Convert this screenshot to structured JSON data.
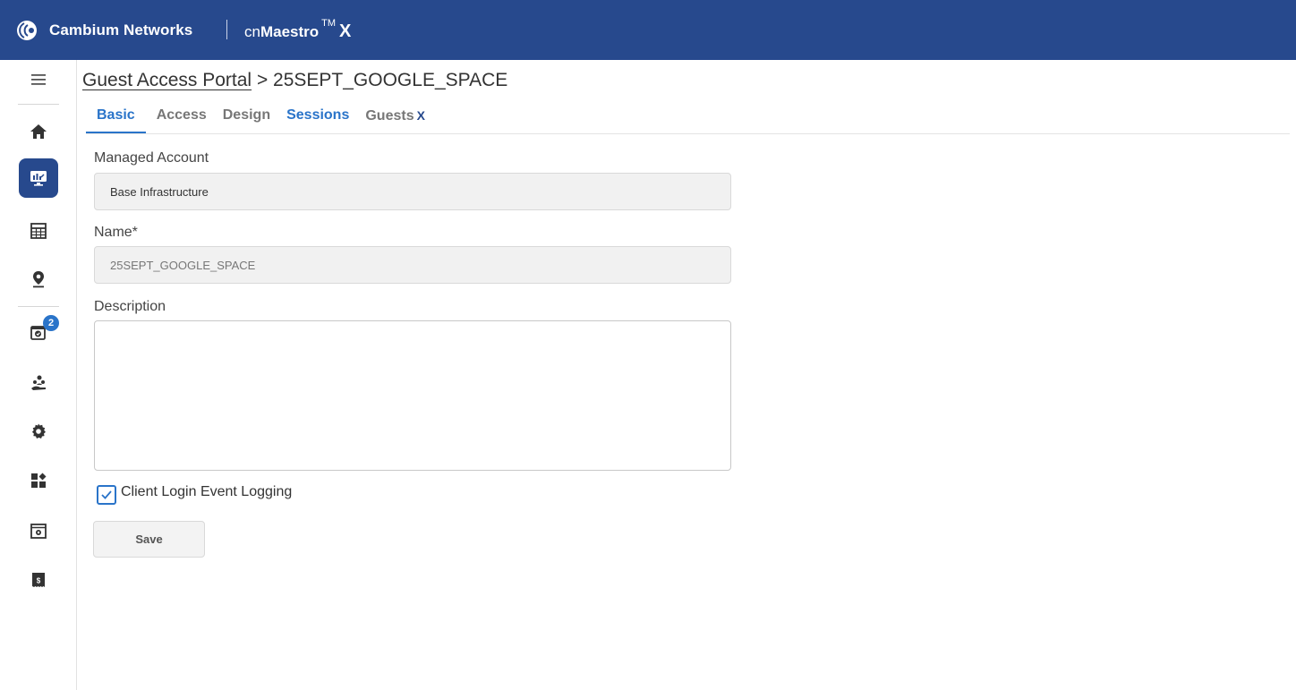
{
  "header": {
    "brand": "Cambium Networks",
    "product_prefix": "cn",
    "product_name": "Maestro",
    "product_tm": "TM",
    "product_suffix": "X"
  },
  "sidebar": {
    "items": [
      {
        "icon": "menu-icon"
      },
      {
        "icon": "home-icon"
      },
      {
        "icon": "monitor-icon",
        "active": true
      },
      {
        "icon": "table-icon"
      },
      {
        "icon": "location-pin-icon"
      },
      {
        "icon": "calendar-check-icon",
        "badge": "2"
      },
      {
        "icon": "users-icon"
      },
      {
        "icon": "gear-icon"
      },
      {
        "icon": "apps-icon"
      },
      {
        "icon": "window-settings-icon"
      },
      {
        "icon": "license-icon"
      }
    ]
  },
  "breadcrumb": {
    "parent": "Guest Access Portal",
    "separator": ">",
    "current": "25SEPT_GOOGLE_SPACE"
  },
  "tabs": [
    {
      "label": "Basic",
      "active": true
    },
    {
      "label": "Access"
    },
    {
      "label": "Design"
    },
    {
      "label": "Sessions"
    },
    {
      "label": "Guests",
      "suffix": "X"
    }
  ],
  "form": {
    "managed_account_label": "Managed Account",
    "managed_account_value": "Base Infrastructure",
    "name_label": "Name*",
    "name_value": "25SEPT_GOOGLE_SPACE",
    "description_label": "Description",
    "description_value": "",
    "logging_label": "Client Login Event Logging",
    "logging_checked": true,
    "save_label": "Save"
  },
  "colors": {
    "header_bg": "#27498d",
    "accent": "#2a74c9"
  }
}
